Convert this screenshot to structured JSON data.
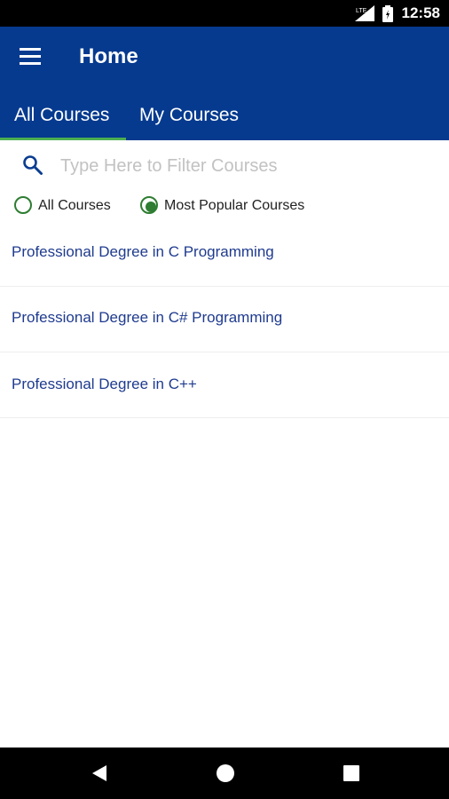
{
  "status_bar": {
    "network": "LTE",
    "time": "12:58"
  },
  "app_bar": {
    "title": "Home"
  },
  "tabs": [
    {
      "label": "All Courses",
      "active": true
    },
    {
      "label": "My Courses",
      "active": false
    }
  ],
  "search": {
    "placeholder": "Type Here to Filter Courses",
    "value": ""
  },
  "filters": {
    "options": [
      {
        "label": "All Courses",
        "selected": false
      },
      {
        "label": "Most Popular Courses",
        "selected": true
      }
    ]
  },
  "courses": [
    {
      "title": "Professional Degree in C Programming"
    },
    {
      "title": "Professional Degree in C# Programming"
    },
    {
      "title": "Professional Degree in C++"
    }
  ],
  "colors": {
    "app_bar": "#053a8f",
    "tab_indicator": "#4caf50",
    "radio_accent": "#2e7d32",
    "course_text": "#1f3b8f",
    "search_icon": "#0b3d91"
  },
  "icons": {
    "menu": "menu-icon",
    "search": "search-icon",
    "back": "back-icon",
    "home": "home-icon",
    "recents": "recents-icon"
  }
}
